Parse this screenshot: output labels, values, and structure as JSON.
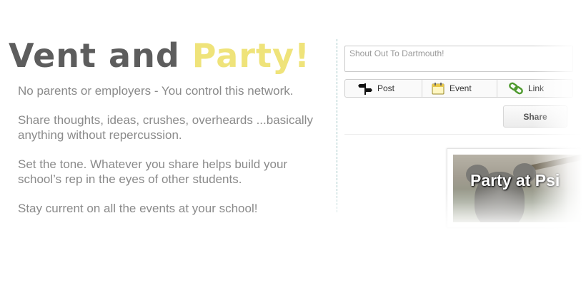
{
  "headline": {
    "part1": "Vent and ",
    "part2": "Party!"
  },
  "paragraphs": [
    "No parents or employers - You control this network.",
    "Share thoughts, ideas, crushes, overheards ...basically anything without repercussion.",
    "Set the tone.  Whatever you share helps build your school’s rep in the eyes of other students.",
    "Stay current on all the events at your school!"
  ],
  "composer": {
    "placeholder": "Shout Out To Dartmouth!",
    "types": [
      {
        "label": "Post",
        "icon": "signpost-icon"
      },
      {
        "label": "Event",
        "icon": "calendar-icon"
      },
      {
        "label": "Link",
        "icon": "chain-link-icon"
      }
    ],
    "share_label": "Share"
  },
  "event_card": {
    "title": "Party at Psi"
  },
  "colors": {
    "accent": "#efe37a",
    "headline_dark": "#5d5d5d",
    "body_text": "#8a8a8a"
  }
}
